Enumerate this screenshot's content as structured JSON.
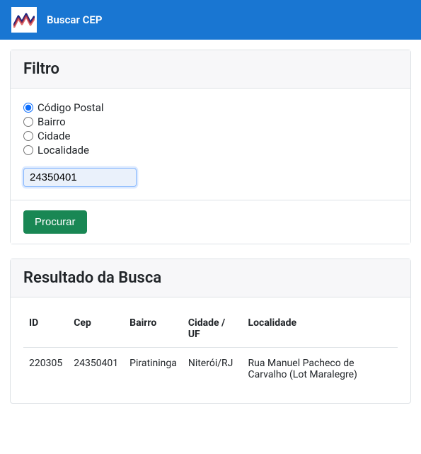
{
  "navbar": {
    "title": "Buscar CEP"
  },
  "filter": {
    "heading": "Filtro",
    "options": [
      {
        "label": "Código Postal",
        "checked": true
      },
      {
        "label": "Bairro",
        "checked": false
      },
      {
        "label": "Cidade",
        "checked": false
      },
      {
        "label": "Localidade",
        "checked": false
      }
    ],
    "search_value": "24350401",
    "submit_label": "Procurar"
  },
  "results": {
    "heading": "Resultado da Busca",
    "columns": [
      "ID",
      "Cep",
      "Bairro",
      "Cidade / UF",
      "Localidade"
    ],
    "rows": [
      {
        "id": "220305",
        "cep": "24350401",
        "bairro": "Piratininga",
        "cidade_uf": "Niterói/RJ",
        "localidade": "Rua Manuel Pacheco de Carvalho (Lot Maralegre)"
      }
    ]
  }
}
